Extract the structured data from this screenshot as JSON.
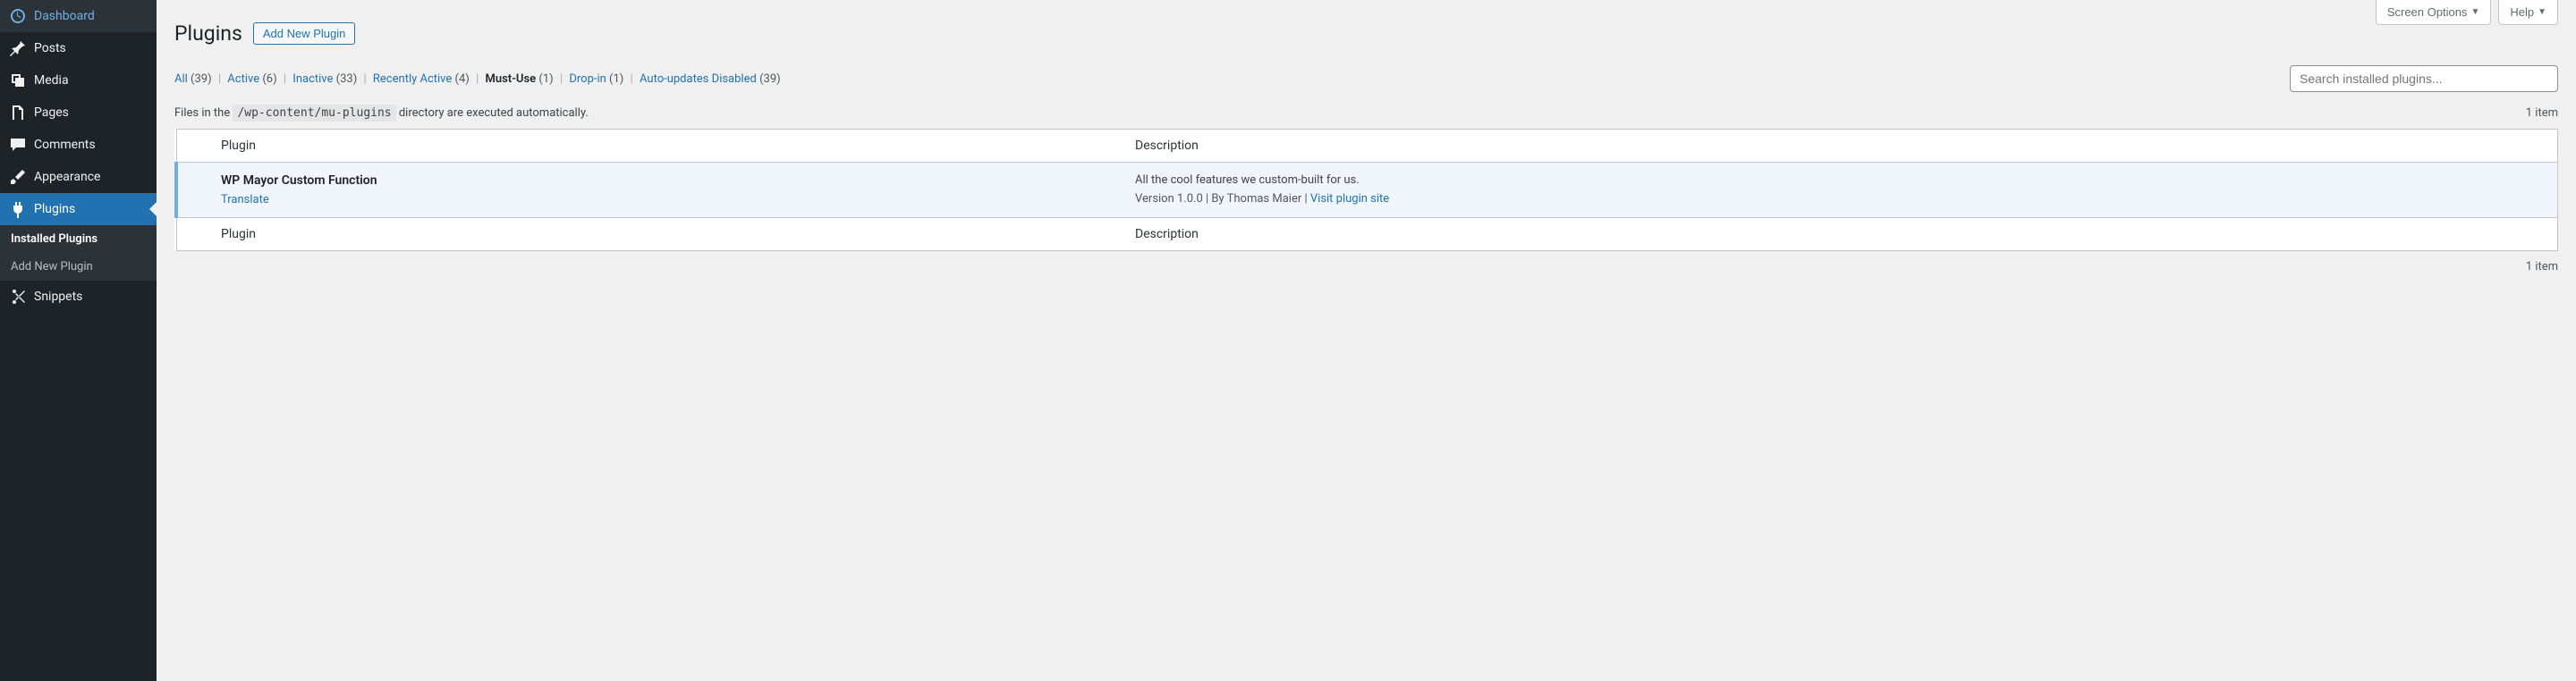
{
  "sidebar": {
    "items": [
      {
        "label": "Dashboard"
      },
      {
        "label": "Posts"
      },
      {
        "label": "Media"
      },
      {
        "label": "Pages"
      },
      {
        "label": "Comments"
      },
      {
        "label": "Appearance"
      },
      {
        "label": "Plugins"
      },
      {
        "label": "Snippets"
      }
    ],
    "submenu": [
      {
        "label": "Installed Plugins"
      },
      {
        "label": "Add New Plugin"
      }
    ]
  },
  "top_actions": {
    "screen_options": "Screen Options",
    "help": "Help"
  },
  "heading": {
    "title": "Plugins",
    "add_new": "Add New Plugin"
  },
  "filters": [
    {
      "label": "All",
      "count": "(39)"
    },
    {
      "label": "Active",
      "count": "(6)"
    },
    {
      "label": "Inactive",
      "count": "(33)"
    },
    {
      "label": "Recently Active",
      "count": "(4)"
    },
    {
      "label": "Must-Use",
      "count": "(1)"
    },
    {
      "label": "Drop-in",
      "count": "(1)"
    },
    {
      "label": "Auto-updates Disabled",
      "count": "(39)"
    }
  ],
  "search": {
    "placeholder": "Search installed plugins..."
  },
  "info": {
    "prefix": "Files in the ",
    "code": "/wp-content/mu-plugins",
    "suffix": " directory are executed automatically.",
    "item_count": "1 item"
  },
  "table": {
    "headers": {
      "plugin": "Plugin",
      "description": "Description"
    },
    "row": {
      "name": "WP Mayor Custom Function",
      "action": "Translate",
      "description": "All the cool features we custom-built for us.",
      "meta_version": "Version 1.0.0",
      "meta_author": "By Thomas Maier",
      "meta_link": "Visit plugin site",
      "meta_sep": " | "
    }
  },
  "bottom": {
    "item_count": "1 item"
  }
}
